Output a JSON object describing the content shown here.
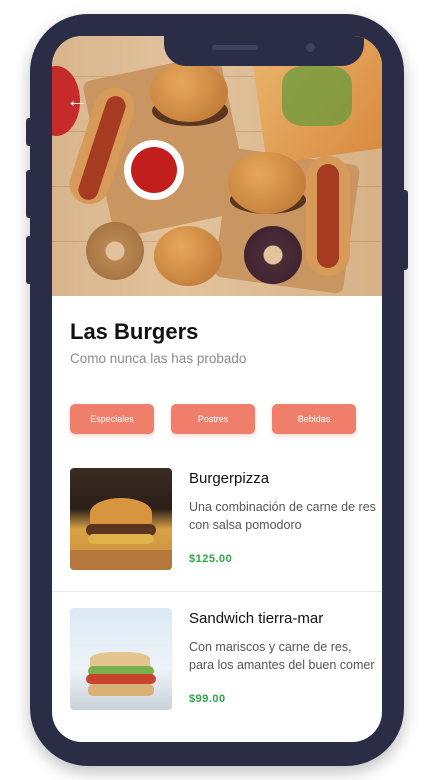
{
  "restaurant": {
    "title": "Las Burgers",
    "subtitle": "Como nunca las has probado"
  },
  "navigation": {
    "back_icon": "arrow-left-icon"
  },
  "categories": [
    {
      "label": "Especiales"
    },
    {
      "label": "Postres"
    },
    {
      "label": "Bebidas"
    }
  ],
  "menu_items": [
    {
      "name": "Burgerpizza",
      "description": "Una combinación de carne de res con salsa pomodoro",
      "price": "$125.00"
    },
    {
      "name": "Sandwich tierra-mar",
      "description": "Con mariscos y carne de res, para los amantes del buen comer",
      "price": "$99.00"
    }
  ],
  "colors": {
    "accent": "#ef7e6b",
    "price": "#2ea34d",
    "frame": "#2a2d45"
  }
}
